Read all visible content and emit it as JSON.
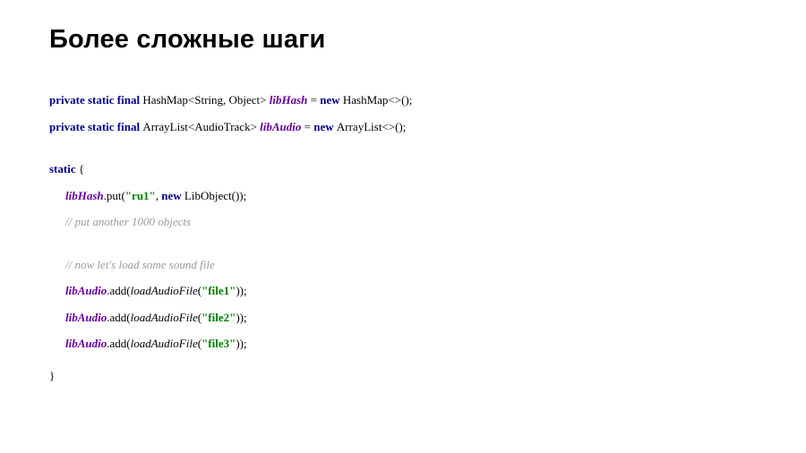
{
  "title": "Более сложные шаги",
  "line1": {
    "kw1": "private static final ",
    "type": "HashMap<String, Object> ",
    "field": "libHash ",
    "eq": "= ",
    "kw2": "new ",
    "ctor": "HashMap<>();"
  },
  "line2": {
    "kw1": "private static final ",
    "type": "ArrayList<AudioTrack> ",
    "field": "libAudio ",
    "eq": "= ",
    "kw2": "new ",
    "ctor": "ArrayList<>();"
  },
  "staticBlock": {
    "open_kw": "static",
    "open_brace": " {",
    "put": {
      "field": "libHash",
      "dot_put_open": ".put(",
      "key": "\"ru1\"",
      "comma": ", ",
      "new_kw": "new ",
      "obj": "LibObject());"
    },
    "comment1": "// put another 1000 objects",
    "comment2": "// now let's load some sound file",
    "audio": [
      {
        "field": "libAudio",
        "dot_add_open": ".add(",
        "loader": "loadAudioFile",
        "paren": "(",
        "arg": "\"file1\"",
        "close": "));"
      },
      {
        "field": "libAudio",
        "dot_add_open": ".add(",
        "loader": "loadAudioFile",
        "paren": "(",
        "arg": "\"file2\"",
        "close": "));"
      },
      {
        "field": "libAudio",
        "dot_add_open": ".add(",
        "loader": "loadAudioFile",
        "paren": "(",
        "arg": "\"file3\"",
        "close": "));"
      }
    ],
    "close_brace": "}"
  }
}
